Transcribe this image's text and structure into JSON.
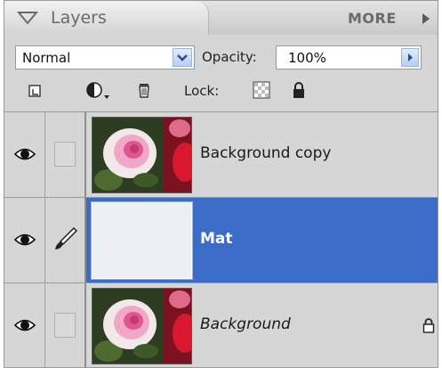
{
  "panel": {
    "title": "Layers",
    "more_label": "MORE"
  },
  "blend_mode": {
    "selected": "Normal"
  },
  "opacity": {
    "label": "Opacity:",
    "value": "100%"
  },
  "tools": {
    "lock_label": "Lock:"
  },
  "layers": [
    {
      "name": "Background copy",
      "visible": true,
      "selected": false,
      "thumbnail": "rose-photo-icon"
    },
    {
      "name": "Mat",
      "visible": true,
      "selected": true,
      "thumbnail": "blank-mat"
    },
    {
      "name": "Background",
      "visible": true,
      "selected": false,
      "locked": true,
      "thumbnail": "rose-photo-icon"
    }
  ],
  "colors": {
    "selection": "#3a6cc8",
    "panel_bg": "#d6d6d6"
  }
}
